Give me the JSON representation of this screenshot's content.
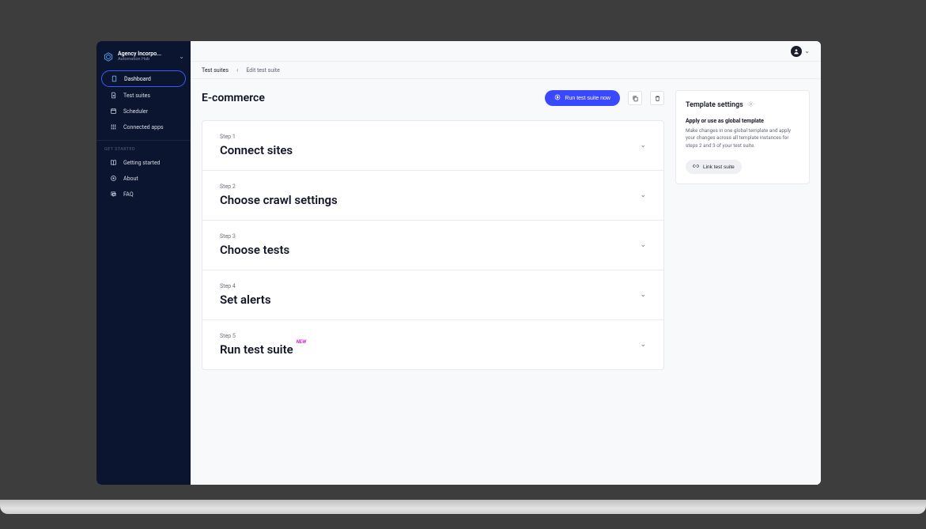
{
  "org": {
    "name": "Agency Incorpo...",
    "sub": "Automation Hub"
  },
  "sidebar": {
    "main": [
      {
        "id": "dashboard",
        "label": "Dashboard",
        "active": true
      },
      {
        "id": "test-suites",
        "label": "Test suites",
        "active": false
      },
      {
        "id": "scheduler",
        "label": "Scheduler",
        "active": false
      },
      {
        "id": "connected",
        "label": "Connected apps",
        "active": false
      }
    ],
    "section_label": "GET STARTED",
    "secondary": [
      {
        "id": "getting-started",
        "label": "Getting started"
      },
      {
        "id": "about",
        "label": "About"
      },
      {
        "id": "faq",
        "label": "FAQ"
      }
    ]
  },
  "breadcrumb": {
    "root": "Test suites",
    "current": "Edit test suite"
  },
  "page": {
    "title": "E-commerce",
    "run_label": "Run test suite now"
  },
  "steps": [
    {
      "label": "Step 1",
      "title": "Connect sites",
      "new": false
    },
    {
      "label": "Step 2",
      "title": "Choose crawl settings",
      "new": false
    },
    {
      "label": "Step 3",
      "title": "Choose tests",
      "new": false
    },
    {
      "label": "Step 4",
      "title": "Set alerts",
      "new": false
    },
    {
      "label": "Step 5",
      "title": "Run test suite",
      "new": true
    }
  ],
  "new_badge": "NEW",
  "template_panel": {
    "title": "Template settings",
    "sub": "Apply or use as global template",
    "body": "Make changes in one global template and apply your changes across all template instances for steps 2 and 3 of your test suite.",
    "button": "Link test suite"
  }
}
